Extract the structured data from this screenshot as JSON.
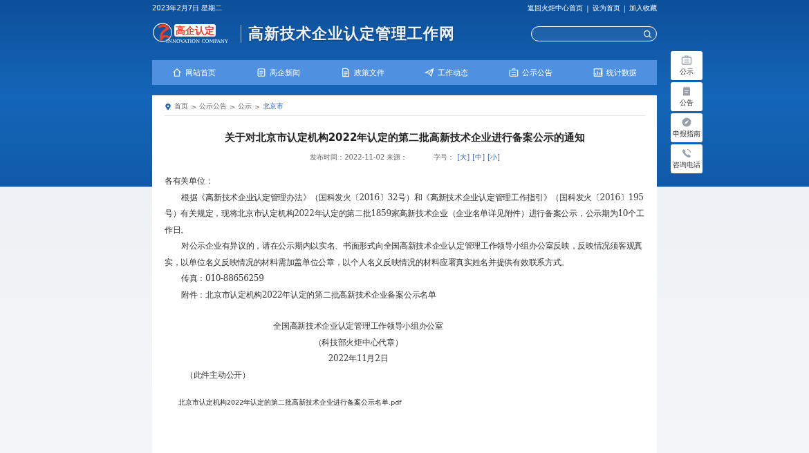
{
  "top_bar": {
    "date": "2023年2月7日 星期二",
    "links": [
      "返回火炬中心首页",
      "设为首页",
      "加入收藏"
    ],
    "separators": [
      "|",
      "|"
    ]
  },
  "header": {
    "logo_text": "高企认定",
    "logo_subtext": "INNOVATION COMPANY",
    "site_title": "高新技术企业认定管理工作网"
  },
  "nav": [
    {
      "label": "网站首页"
    },
    {
      "label": "高企新闻"
    },
    {
      "label": "政策文件"
    },
    {
      "label": "工作动态"
    },
    {
      "label": "公示公告"
    },
    {
      "label": "统计数据"
    }
  ],
  "breadcrumb_separators": [
    ">",
    ">",
    ">"
  ],
  "breadcrumb": [
    {
      "label": "首页",
      "selected": false
    },
    {
      "label": "公示公告",
      "selected": false
    },
    {
      "label": "公示",
      "selected": false
    },
    {
      "label": "北京市",
      "selected": true
    }
  ],
  "article": {
    "title": "关于对北京市认定机构2022年认定的第二批高新技术企业进行备案公示的通知",
    "meta": "发布时间：2022-11-02 来源：",
    "font_size_label": "字号：",
    "font_sizes": [
      "[大]",
      "[中]",
      "[小]"
    ],
    "paragraphs": [
      {
        "kind": "plain",
        "text": "各有关单位："
      },
      {
        "kind": "indent",
        "text": "根据《高新技术企业认定管理办法》（国科发火〔2016〕32号）和《高新技术企业认定管理工作指引》（国科发火〔2016〕195号）有关规定，现将北京市认定机构2022年认定的第二批1859家高新技术企业（企业名单详见附件）进行备案公示，公示期为10个工作日。"
      },
      {
        "kind": "indent",
        "text": "对公示企业有异议的，请在公示期内以实名、书面形式向全国高新技术企业认定管理工作领导小组办公室反映，反映情况须客观真实，以单位名义反映情况的材料需加盖单位公章，以个人名义反映情况的材料应署真实姓名并提供有效联系方式。"
      },
      {
        "kind": "indent",
        "text": "传真：010-88656259"
      },
      {
        "kind": "indent",
        "text": "附件：北京市认定机构2022年认定的第二批高新技术企业备案公示名单"
      }
    ],
    "signature": [
      "全国高新技术企业认定管理工作领导小组办公室",
      "（科技部火炬中心代章）",
      "2022年11月2日"
    ],
    "note": "（此件主动公开）",
    "attachment": "北京市认定机构2022年认定的第二批高新技术企业进行备案公示名单.pdf"
  },
  "side_buttons": [
    {
      "label": "公示"
    },
    {
      "label": "公告"
    },
    {
      "label": "申报指南"
    },
    {
      "label": "咨询电话"
    }
  ]
}
